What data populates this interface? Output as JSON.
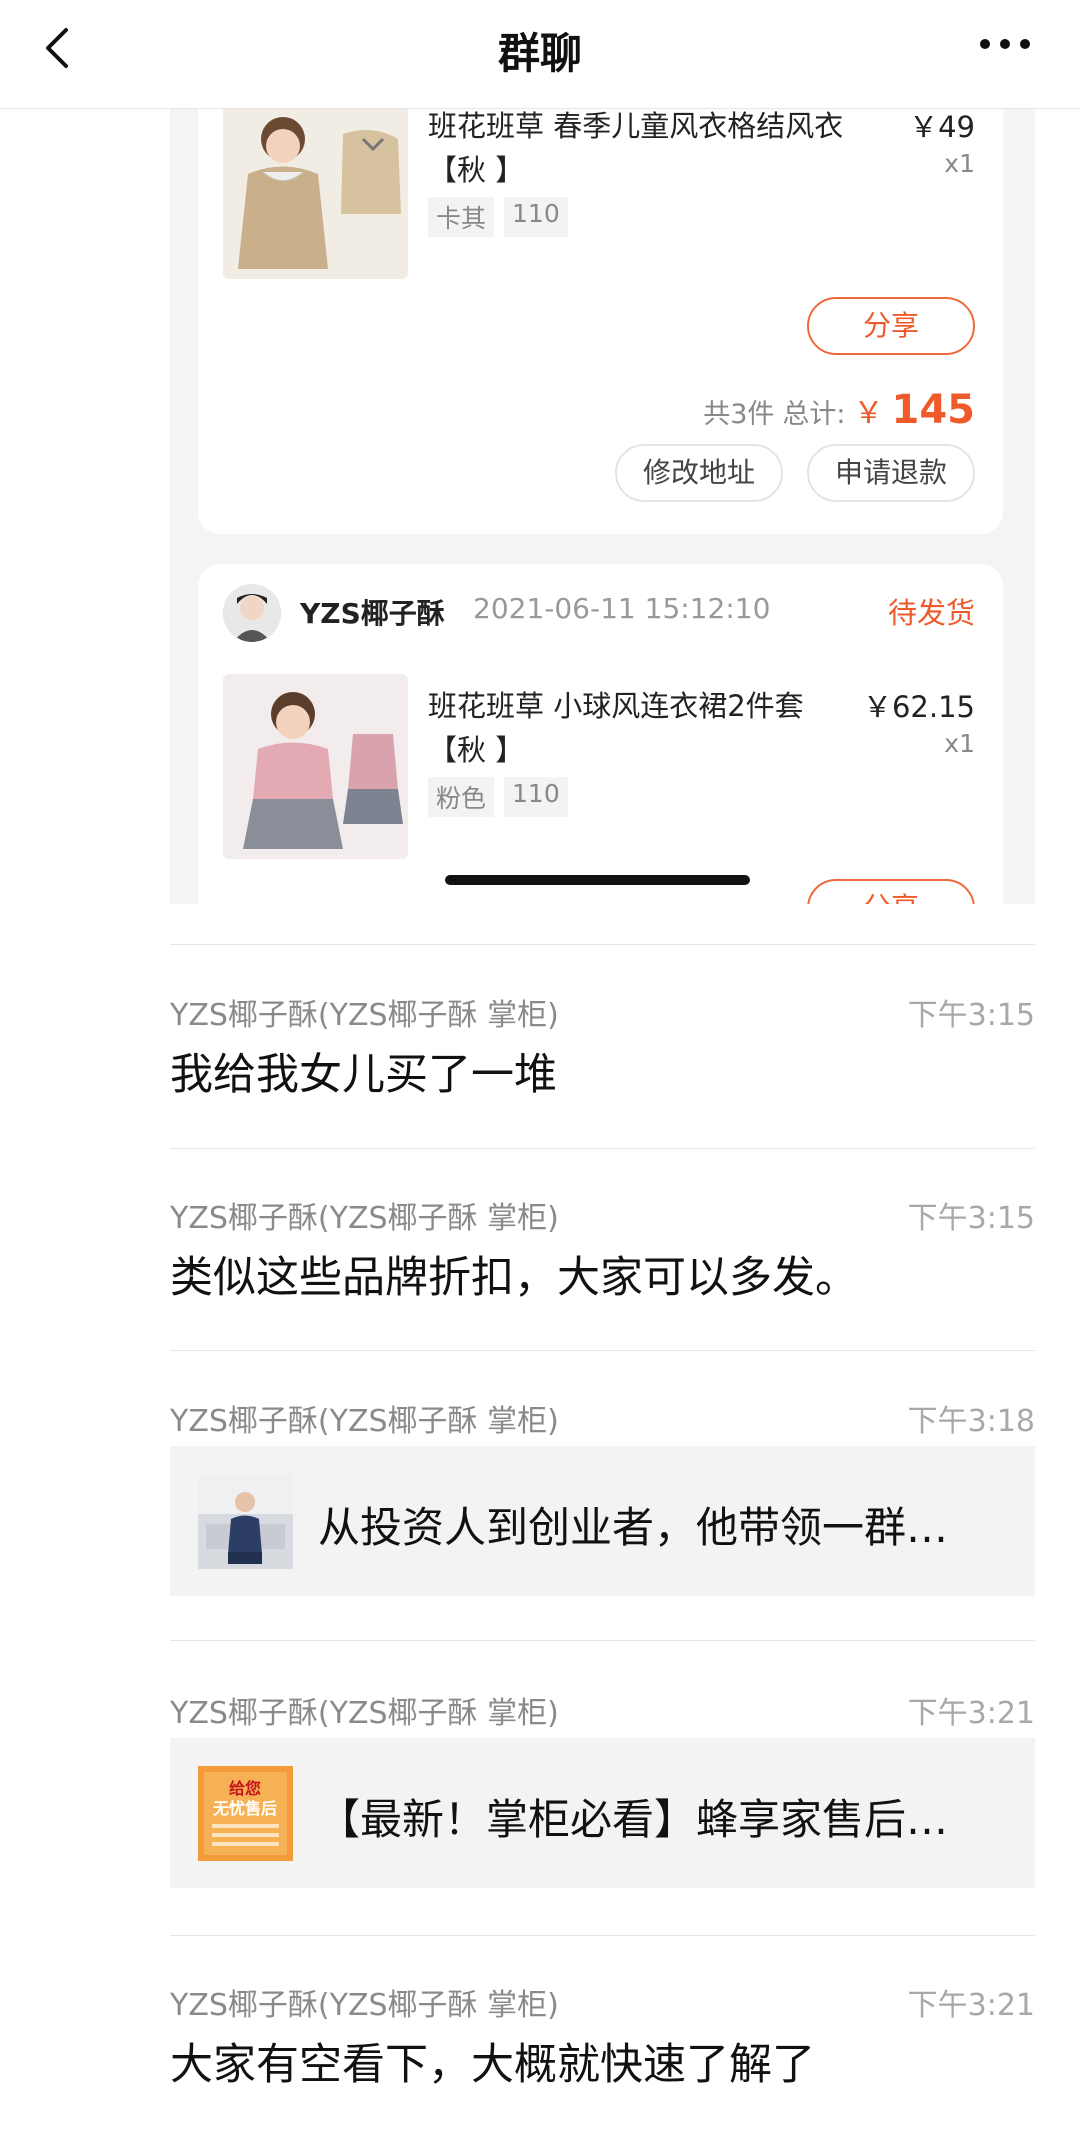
{
  "header": {
    "title": "群聊",
    "back_icon": "chevron-left-icon",
    "more_icon": "more-dots-icon"
  },
  "shot": {
    "order1": {
      "product_name": "班花班草 春季儿童风衣格结风衣【秋 】",
      "price": "￥49",
      "qty": "x1",
      "spec_color": "卡其",
      "spec_size": "110",
      "share_label": "分享",
      "total_count": "共3件",
      "total_label": "总计:",
      "total_yen": "￥",
      "total_amount": "145",
      "edit_address": "修改地址",
      "refund": "申请退款"
    },
    "order2": {
      "seller": "YZS椰子酥",
      "time": "2021-06-11 15:12:10",
      "status": "待发货",
      "product_name": "班花班草 小球风连衣裙2件套【秋 】",
      "price": "￥62.15",
      "qty": "x1",
      "spec_color": "粉色",
      "spec_size": "110",
      "share_label": "分享"
    }
  },
  "messages": [
    {
      "sender": "YZS椰子酥(YZS椰子酥  掌柜)",
      "time": "下午3:15",
      "text": "我给我女儿买了一堆"
    },
    {
      "sender": "YZS椰子酥(YZS椰子酥  掌柜)",
      "time": "下午3:15",
      "text": "类似这些品牌折扣，大家可以多发。"
    },
    {
      "sender": "YZS椰子酥(YZS椰子酥  掌柜)",
      "time": "下午3:18",
      "link_title": "从投资人到创业者，他带领一群…"
    },
    {
      "sender": "YZS椰子酥(YZS椰子酥  掌柜)",
      "time": "下午3:21",
      "link_title": "【最新！掌柜必看】蜂享家售后…",
      "thumb_text_1": "给您",
      "thumb_text_2": "无忧售后"
    },
    {
      "sender": "YZS椰子酥(YZS椰子酥  掌柜)",
      "time": "下午3:21",
      "text": "大家有空看下，大概就快速了解了"
    }
  ],
  "colors": {
    "accent": "#ee5a2a",
    "divider": "#e6e6e6",
    "card_bg": "#f3f3f3"
  }
}
